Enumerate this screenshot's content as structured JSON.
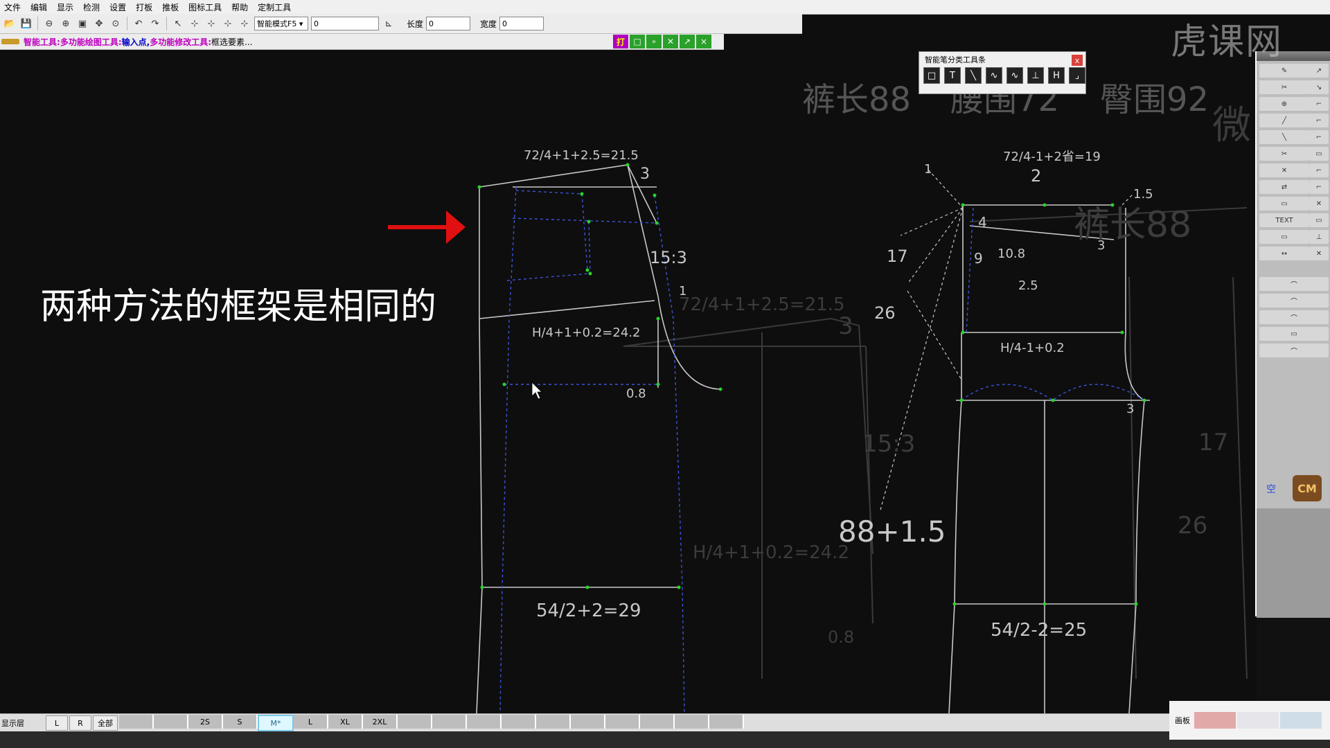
{
  "menu": [
    "文件",
    "编辑",
    "显示",
    "检测",
    "设置",
    "打板",
    "推板",
    "图标工具",
    "帮助",
    "定制工具"
  ],
  "toolbar": {
    "mode_select": "智能模式F5",
    "field_zero": "0",
    "length_label": "长度",
    "length_value": "0",
    "width_label": "宽度",
    "width_value": "0"
  },
  "hint": {
    "tool_label": "智能工具:",
    "tool1": "多功能绘图工具:",
    "action1": "输入点,",
    "tool2": "多功能修改工具:",
    "action2": "框选要素..."
  },
  "mini_buttons": [
    "打",
    "□",
    "∘",
    "✕",
    "↗",
    "×"
  ],
  "palette": {
    "title": "智能笔分类工具条",
    "close": "x",
    "tools": [
      "□",
      "T",
      "╲",
      "∿",
      "∿",
      "⊥",
      "H",
      "⌟"
    ]
  },
  "overlay_caption": "两种方法的框架是相同的",
  "canvas_labels": {
    "header_length": "裤长88",
    "header_waist": "腰围72",
    "header_hip": "臀围92",
    "front_waist": "72/4+1+2.5=21.5",
    "front_3": "3",
    "front_ratio": "15:3",
    "front_1": "1",
    "front_hip": "H/4+1+0.2=24.2",
    "front_crotch": "0.8",
    "front_knee": "54/2+2=29",
    "back_waist": "72/4-1+2省=19",
    "back_2": "2",
    "back_1": "1",
    "back_1_5": "1.5",
    "back_4": "4",
    "back_9": "9",
    "back_10_8": "10.8",
    "back_2_5": "2.5",
    "back_3": "3",
    "back_17": "17",
    "back_26": "26",
    "back_hip": "H/4-1+0.2",
    "back_crotch_3": "3",
    "back_length": "88+1.5",
    "back_knee": "54/2-2=25",
    "ghost_waist": "72/4+1+2.5=21.5",
    "ghost_3": "3",
    "ghost_ratio": "15:3",
    "ghost_hip": "H/4+1+0.2=24.2",
    "ghost_crotch": "0.8",
    "ghost_length": "裤长88",
    "ghost_17": "17",
    "ghost_26": "26",
    "ghost_wei": "微"
  },
  "side_panel": {
    "tools": [
      "✎",
      "↗",
      "✂",
      "↘",
      "⊕",
      "⌐",
      "╱",
      "⌐",
      "╲",
      "⌐",
      "✂",
      "▭",
      "✕",
      "⌐",
      "⇄",
      "⌐",
      "▭",
      "✕",
      "TEXT",
      "▭",
      "▭",
      "⊥",
      "↔",
      "✕"
    ],
    "tools_lower": [
      "⌒",
      "⌒",
      "⌒",
      "▭",
      "⌒"
    ],
    "kong": "空",
    "cm": "CM"
  },
  "status": {
    "layer_label": "显示层",
    "buttons": [
      "L",
      "R",
      "全部"
    ],
    "sizes": [
      "",
      "",
      "2S",
      "S",
      "M*",
      "L",
      "XL",
      "2XL",
      "",
      "",
      "",
      "",
      "",
      "",
      "",
      "",
      "",
      ""
    ],
    "active_size": "M*",
    "corner_label": "画板"
  },
  "watermark": "虎课网",
  "colors": {
    "line": "#c8c8c8",
    "dash": "#3a55d8",
    "points": "#27d427",
    "ghost": "#3a3a3a",
    "arrow": "#e01010"
  }
}
